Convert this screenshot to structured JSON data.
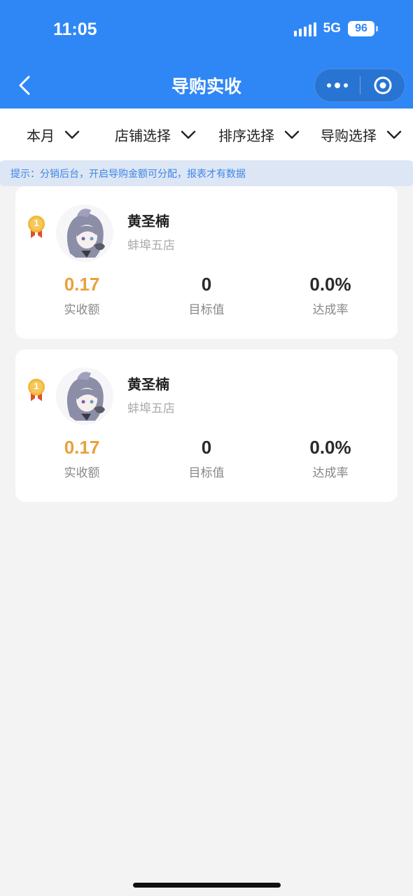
{
  "status": {
    "time": "11:05",
    "network": "5G",
    "battery": "96"
  },
  "nav": {
    "title": "导购实收"
  },
  "filters": [
    "本月",
    "店铺选择",
    "排序选择",
    "导购选择"
  ],
  "notice": "提示：分销后台，开启导购金额可分配，报表才有数据",
  "cards": [
    {
      "rank": "1",
      "name": "黄圣楠",
      "store": "蚌埠五店",
      "metrics": [
        {
          "value": "0.17",
          "label": "实收额"
        },
        {
          "value": "0",
          "label": "目标值"
        },
        {
          "value": "0.0%",
          "label": "达成率"
        }
      ]
    },
    {
      "rank": "1",
      "name": "黄圣楠",
      "store": "蚌埠五店",
      "metrics": [
        {
          "value": "0.17",
          "label": "实收额"
        },
        {
          "value": "0",
          "label": "目标值"
        },
        {
          "value": "0.0%",
          "label": "达成率"
        }
      ]
    }
  ],
  "colors": {
    "primary": "#2f87f5",
    "accent": "#e8a13a",
    "notice_bg": "#dde6f4"
  }
}
